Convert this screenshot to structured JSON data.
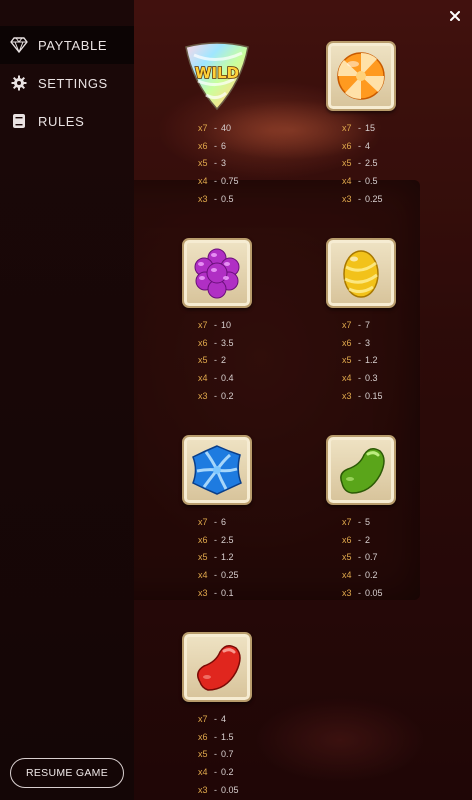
{
  "nav": {
    "items": [
      {
        "label": "PAYTABLE",
        "icon": "diamond-icon",
        "active": true
      },
      {
        "label": "SETTINGS",
        "icon": "gear-icon",
        "active": false
      },
      {
        "label": "RULES",
        "icon": "book-icon",
        "active": false
      }
    ],
    "resume_label": "RESUME GAME"
  },
  "close_icon": "close-icon",
  "symbols": [
    {
      "name": "wild",
      "icon": "wild-candy-icon",
      "wild_text": "WILD",
      "pays": [
        {
          "m": "x7",
          "v": "40"
        },
        {
          "m": "x6",
          "v": "6"
        },
        {
          "m": "x5",
          "v": "3"
        },
        {
          "m": "x4",
          "v": "0.75"
        },
        {
          "m": "x3",
          "v": "0.5"
        }
      ]
    },
    {
      "name": "orange-swirl",
      "icon": "orange-swirl-candy-icon",
      "pays": [
        {
          "m": "x7",
          "v": "15"
        },
        {
          "m": "x6",
          "v": "4"
        },
        {
          "m": "x5",
          "v": "2.5"
        },
        {
          "m": "x4",
          "v": "0.5"
        },
        {
          "m": "x3",
          "v": "0.25"
        }
      ]
    },
    {
      "name": "purple-rock",
      "icon": "purple-rock-candy-icon",
      "pays": [
        {
          "m": "x7",
          "v": "10"
        },
        {
          "m": "x6",
          "v": "3.5"
        },
        {
          "m": "x5",
          "v": "2"
        },
        {
          "m": "x4",
          "v": "0.4"
        },
        {
          "m": "x3",
          "v": "0.2"
        }
      ]
    },
    {
      "name": "yellow-egg",
      "icon": "yellow-egg-candy-icon",
      "pays": [
        {
          "m": "x7",
          "v": "7"
        },
        {
          "m": "x6",
          "v": "3"
        },
        {
          "m": "x5",
          "v": "1.2"
        },
        {
          "m": "x4",
          "v": "0.3"
        },
        {
          "m": "x3",
          "v": "0.15"
        }
      ]
    },
    {
      "name": "blue-swirl",
      "icon": "blue-swirl-candy-icon",
      "pays": [
        {
          "m": "x7",
          "v": "6"
        },
        {
          "m": "x6",
          "v": "2.5"
        },
        {
          "m": "x5",
          "v": "1.2"
        },
        {
          "m": "x4",
          "v": "0.25"
        },
        {
          "m": "x3",
          "v": "0.1"
        }
      ]
    },
    {
      "name": "green-bean",
      "icon": "green-jelly-bean-icon",
      "pays": [
        {
          "m": "x7",
          "v": "5"
        },
        {
          "m": "x6",
          "v": "2"
        },
        {
          "m": "x5",
          "v": "0.7"
        },
        {
          "m": "x4",
          "v": "0.2"
        },
        {
          "m": "x3",
          "v": "0.05"
        }
      ]
    },
    {
      "name": "red-bean",
      "icon": "red-jelly-bean-icon",
      "pays": [
        {
          "m": "x7",
          "v": "4"
        },
        {
          "m": "x6",
          "v": "1.5"
        },
        {
          "m": "x5",
          "v": "0.7"
        },
        {
          "m": "x4",
          "v": "0.2"
        },
        {
          "m": "x3",
          "v": "0.05"
        }
      ]
    }
  ],
  "colors": {
    "multiplier": "#e0a94c",
    "value": "#d8d0d0",
    "accent": "#b89c6c"
  }
}
